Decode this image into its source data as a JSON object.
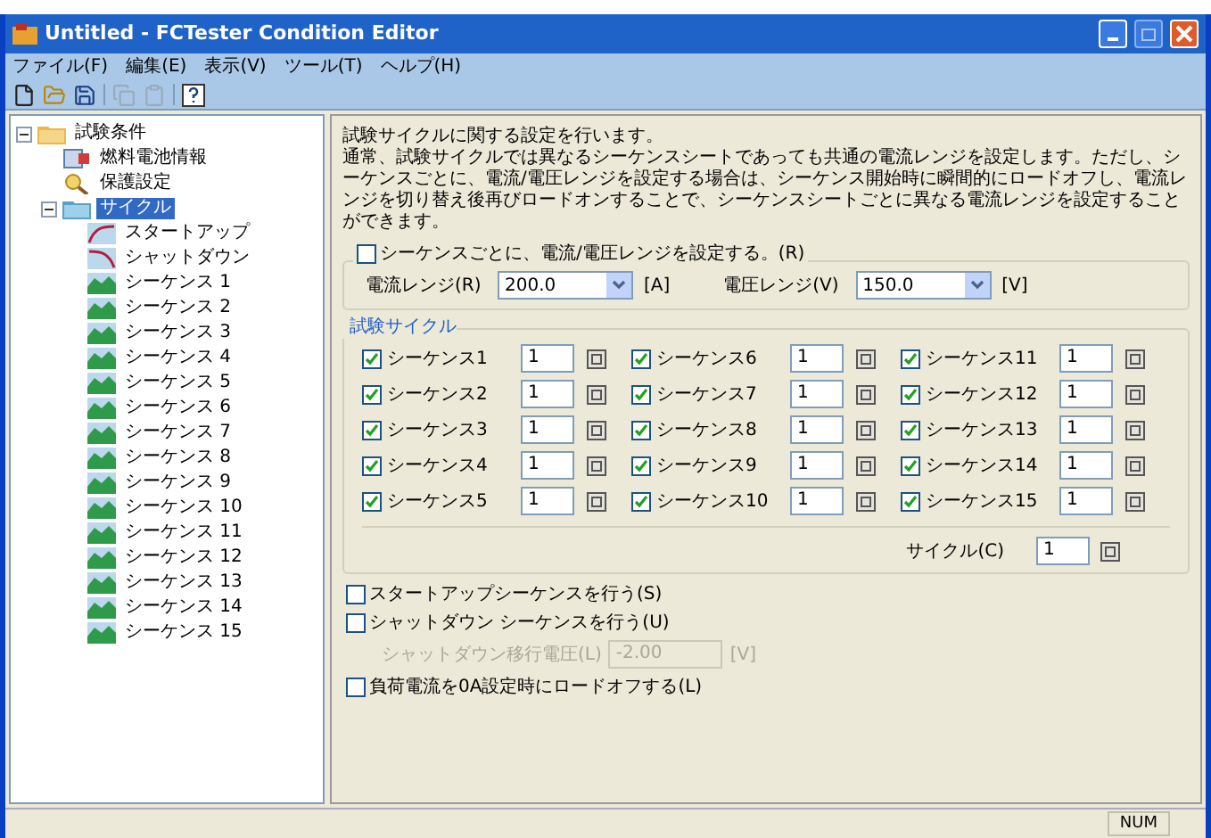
{
  "window": {
    "title": "Untitled - FCTester Condition Editor"
  },
  "menu": [
    "ファイル(F)",
    "編集(E)",
    "表示(V)",
    "ツール(T)",
    "ヘルプ(H)"
  ],
  "tree": {
    "label": "試験条件",
    "kind": "folder",
    "expanded": true,
    "selected": false,
    "children": [
      {
        "label": "燃料電池情報",
        "kind": "info",
        "selected": false
      },
      {
        "label": "保護設定",
        "kind": "protect",
        "selected": false
      },
      {
        "label": "サイクル",
        "kind": "cycle",
        "expanded": true,
        "selected": true,
        "children": [
          {
            "label": "スタートアップ",
            "kind": "startup",
            "selected": false
          },
          {
            "label": "シャットダウン",
            "kind": "shutdown",
            "selected": false
          },
          {
            "label": "シーケンス 1",
            "kind": "sequence",
            "selected": false
          },
          {
            "label": "シーケンス 2",
            "kind": "sequence",
            "selected": false
          },
          {
            "label": "シーケンス 3",
            "kind": "sequence",
            "selected": false
          },
          {
            "label": "シーケンス 4",
            "kind": "sequence",
            "selected": false
          },
          {
            "label": "シーケンス 5",
            "kind": "sequence",
            "selected": false
          },
          {
            "label": "シーケンス 6",
            "kind": "sequence",
            "selected": false
          },
          {
            "label": "シーケンス 7",
            "kind": "sequence",
            "selected": false
          },
          {
            "label": "シーケンス 8",
            "kind": "sequence",
            "selected": false
          },
          {
            "label": "シーケンス 9",
            "kind": "sequence",
            "selected": false
          },
          {
            "label": "シーケンス 10",
            "kind": "sequence",
            "selected": false
          },
          {
            "label": "シーケンス 11",
            "kind": "sequence",
            "selected": false
          },
          {
            "label": "シーケンス 12",
            "kind": "sequence",
            "selected": false
          },
          {
            "label": "シーケンス 13",
            "kind": "sequence",
            "selected": false
          },
          {
            "label": "シーケンス 14",
            "kind": "sequence",
            "selected": false
          },
          {
            "label": "シーケンス 15",
            "kind": "sequence",
            "selected": false
          }
        ]
      }
    ]
  },
  "description": [
    "試験サイクルに関する設定を行います。",
    "通常、試験サイクルでは異なるシーケンスシートであっても共通の電流レンジを設定します。ただし、シーケンスごとに、電流/電圧レンジを設定する場合は、シーケンス開始時に瞬間的にロードオフし、電流レンジを切り替え後再びロードオンすることで、シーケンスシートごとに異なる電流レンジを設定することができます。"
  ],
  "range_group": {
    "checkbox": {
      "label": "シーケンスごとに、電流/電圧レンジを設定する。(R)",
      "checked": false
    },
    "fields": [
      {
        "label": "電流レンジ(R)",
        "value": "200.0",
        "unit": "[A]"
      },
      {
        "label": "電圧レンジ(V)",
        "value": "150.0",
        "unit": "[V]"
      }
    ]
  },
  "cycle_group": {
    "title": "試験サイクル",
    "sequences": [
      {
        "label": "シーケンス1",
        "checked": true,
        "value": "1"
      },
      {
        "label": "シーケンス2",
        "checked": true,
        "value": "1"
      },
      {
        "label": "シーケンス3",
        "checked": true,
        "value": "1"
      },
      {
        "label": "シーケンス4",
        "checked": true,
        "value": "1"
      },
      {
        "label": "シーケンス5",
        "checked": true,
        "value": "1"
      },
      {
        "label": "シーケンス6",
        "checked": true,
        "value": "1"
      },
      {
        "label": "シーケンス7",
        "checked": true,
        "value": "1"
      },
      {
        "label": "シーケンス8",
        "checked": true,
        "value": "1"
      },
      {
        "label": "シーケンス9",
        "checked": true,
        "value": "1"
      },
      {
        "label": "シーケンス10",
        "checked": true,
        "value": "1"
      },
      {
        "label": "シーケンス11",
        "checked": true,
        "value": "1"
      },
      {
        "label": "シーケンス12",
        "checked": true,
        "value": "1"
      },
      {
        "label": "シーケンス13",
        "checked": true,
        "value": "1"
      },
      {
        "label": "シーケンス14",
        "checked": true,
        "value": "1"
      },
      {
        "label": "シーケンス15",
        "checked": true,
        "value": "1"
      }
    ],
    "cycle": {
      "label": "サイクル(C)",
      "value": "1"
    }
  },
  "options": [
    {
      "kind": "checkbox",
      "label": "スタートアップシーケンスを行う(S)",
      "checked": false
    },
    {
      "kind": "checkbox",
      "label": "シャットダウン シーケンスを行う(U)",
      "checked": false
    },
    {
      "kind": "field",
      "label": "シャットダウン移行電圧(L)",
      "value": "-2.00",
      "unit": "[V]",
      "disabled": true
    },
    {
      "kind": "checkbox",
      "label": "負荷電流を0A設定時にロードオフする(L)",
      "checked": false
    }
  ],
  "status_bar": {
    "indicator": "NUM"
  }
}
